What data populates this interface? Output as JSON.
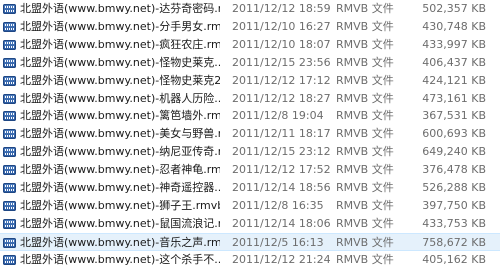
{
  "files": [
    {
      "name": "北盟外语(www.bmwy.net)-达芬奇密码.r...",
      "date": "2011/12/12 18:59",
      "type": "RMVB 文件",
      "size": "502,357 KB"
    },
    {
      "name": "北盟外语(www.bmwy.net)-分手男女.rm...",
      "date": "2011/12/10 16:27",
      "type": "RMVB 文件",
      "size": "430,748 KB"
    },
    {
      "name": "北盟外语(www.bmwy.net)-疯狂农庄.rm...",
      "date": "2011/12/10 18:07",
      "type": "RMVB 文件",
      "size": "433,997 KB"
    },
    {
      "name": "北盟外语(www.bmwy.net)-怪物史莱克....",
      "date": "2011/12/15 23:56",
      "type": "RMVB 文件",
      "size": "406,437 KB"
    },
    {
      "name": "北盟外语(www.bmwy.net)-怪物史莱克2....",
      "date": "2011/12/12 17:12",
      "type": "RMVB 文件",
      "size": "424,121 KB"
    },
    {
      "name": "北盟外语(www.bmwy.net)-机器人历险....",
      "date": "2011/12/12 18:27",
      "type": "RMVB 文件",
      "size": "473,161 KB"
    },
    {
      "name": "北盟外语(www.bmwy.net)-篱笆墙外.rm...",
      "date": "2011/12/8 19:04",
      "type": "RMVB 文件",
      "size": "367,531 KB"
    },
    {
      "name": "北盟外语(www.bmwy.net)-美女与野兽.r...",
      "date": "2011/12/11 18:17",
      "type": "RMVB 文件",
      "size": "600,693 KB"
    },
    {
      "name": "北盟外语(www.bmwy.net)-纳尼亚传奇.r...",
      "date": "2011/12/15 23:12",
      "type": "RMVB 文件",
      "size": "649,240 KB"
    },
    {
      "name": "北盟外语(www.bmwy.net)-忍者神龟.rm...",
      "date": "2011/12/12 17:52",
      "type": "RMVB 文件",
      "size": "376,478 KB"
    },
    {
      "name": "北盟外语(www.bmwy.net)-神奇遥控器....",
      "date": "2011/12/14 18:56",
      "type": "RMVB 文件",
      "size": "526,288 KB"
    },
    {
      "name": "北盟外语(www.bmwy.net)-狮子王.rmvb",
      "date": "2011/12/8 16:35",
      "type": "RMVB 文件",
      "size": "397,750 KB"
    },
    {
      "name": "北盟外语(www.bmwy.net)-鼠国流浪记.r...",
      "date": "2011/12/14 18:06",
      "type": "RMVB 文件",
      "size": "433,753 KB"
    },
    {
      "name": "北盟外语(www.bmwy.net)-音乐之声.rm...",
      "date": "2011/12/5 16:13",
      "type": "RMVB 文件",
      "size": "758,672 KB",
      "selected": true
    },
    {
      "name": "北盟外语(www.bmwy.net)-这个杀手不....",
      "date": "2011/12/12 21:24",
      "type": "RMVB 文件",
      "size": "405,162 KB"
    }
  ]
}
